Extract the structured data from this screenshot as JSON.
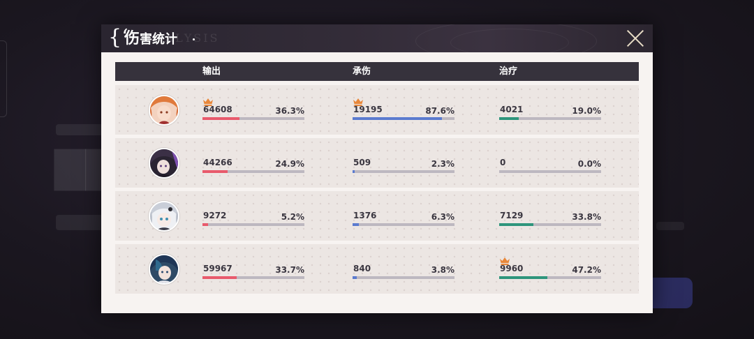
{
  "window": {
    "title_first": "伤",
    "title_rest": "害统计",
    "title_watermark": "ANALYSIS"
  },
  "columns": [
    "输出",
    "承伤",
    "治疗"
  ],
  "colors": {
    "damage_bar": "#e85a6c",
    "tank_bar": "#5b7bcf",
    "heal_bar": "#2e957c",
    "crown": "#e8873a"
  },
  "rows": [
    {
      "avatar": "character-avatar-orange-hair",
      "damage": {
        "value": "64608",
        "percent": "36.3%",
        "fraction": 0.363,
        "crown": true
      },
      "tank": {
        "value": "19195",
        "percent": "87.6%",
        "fraction": 0.876,
        "crown": true
      },
      "heal": {
        "value": "4021",
        "percent": "19.0%",
        "fraction": 0.19,
        "crown": false
      }
    },
    {
      "avatar": "character-avatar-dark-hair",
      "damage": {
        "value": "44266",
        "percent": "24.9%",
        "fraction": 0.249,
        "crown": false
      },
      "tank": {
        "value": "509",
        "percent": "2.3%",
        "fraction": 0.023,
        "crown": false
      },
      "heal": {
        "value": "0",
        "percent": "0.0%",
        "fraction": 0.0,
        "crown": false
      }
    },
    {
      "avatar": "character-avatar-silver-hair",
      "damage": {
        "value": "9272",
        "percent": "5.2%",
        "fraction": 0.052,
        "crown": false
      },
      "tank": {
        "value": "1376",
        "percent": "6.3%",
        "fraction": 0.063,
        "crown": false
      },
      "heal": {
        "value": "7129",
        "percent": "33.8%",
        "fraction": 0.338,
        "crown": false
      }
    },
    {
      "avatar": "character-avatar-blue-hair",
      "damage": {
        "value": "59967",
        "percent": "33.7%",
        "fraction": 0.337,
        "crown": false
      },
      "tank": {
        "value": "840",
        "percent": "3.8%",
        "fraction": 0.038,
        "crown": false
      },
      "heal": {
        "value": "9960",
        "percent": "47.2%",
        "fraction": 0.472,
        "crown": true
      }
    }
  ]
}
